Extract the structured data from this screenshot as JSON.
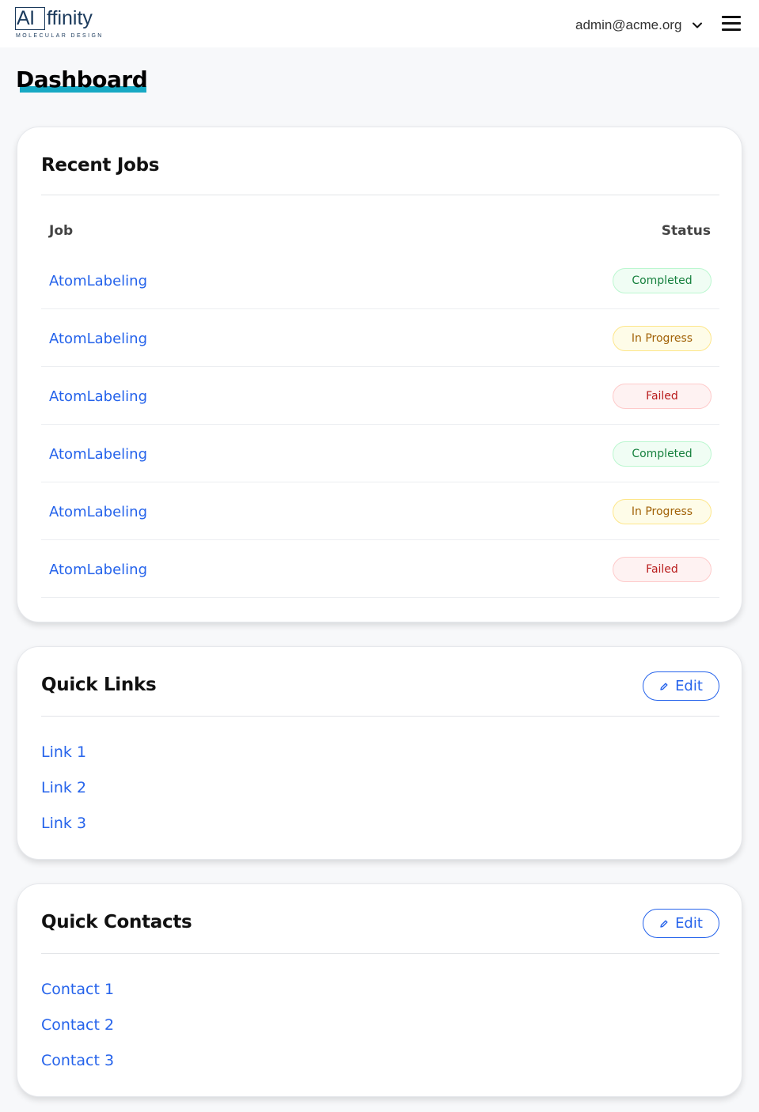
{
  "header": {
    "logo_ai": "AI",
    "logo_rest": "ffinity",
    "logo_tagline": "MOLECULAR DESIGN",
    "user_email": "admin@acme.org",
    "chevron_icon": "chevron-down-icon",
    "menu_icon": "hamburger-menu-icon"
  },
  "page": {
    "title": "Dashboard",
    "accent_color": "#17a9c4"
  },
  "recent_jobs": {
    "title": "Recent Jobs",
    "columns": [
      "Job",
      "Status"
    ],
    "rows": [
      {
        "job": "AtomLabeling",
        "status": "Completed",
        "status_type": "completed"
      },
      {
        "job": "AtomLabeling",
        "status": "In Progress",
        "status_type": "progress"
      },
      {
        "job": "AtomLabeling",
        "status": "Failed",
        "status_type": "failed"
      },
      {
        "job": "AtomLabeling",
        "status": "Completed",
        "status_type": "completed"
      },
      {
        "job": "AtomLabeling",
        "status": "In Progress",
        "status_type": "progress"
      },
      {
        "job": "AtomLabeling",
        "status": "Failed",
        "status_type": "failed"
      }
    ]
  },
  "quick_links": {
    "title": "Quick Links",
    "edit_label": "Edit",
    "edit_icon": "pencil-icon",
    "items": [
      "Link 1",
      "Link 2",
      "Link 3"
    ]
  },
  "quick_contacts": {
    "title": "Quick Contacts",
    "edit_label": "Edit",
    "edit_icon": "pencil-icon",
    "items": [
      "Contact 1",
      "Contact 2",
      "Contact 3"
    ]
  },
  "colors": {
    "link": "#2563eb",
    "completed": "#15803d",
    "in_progress": "#a16207",
    "failed": "#b91c1c"
  }
}
